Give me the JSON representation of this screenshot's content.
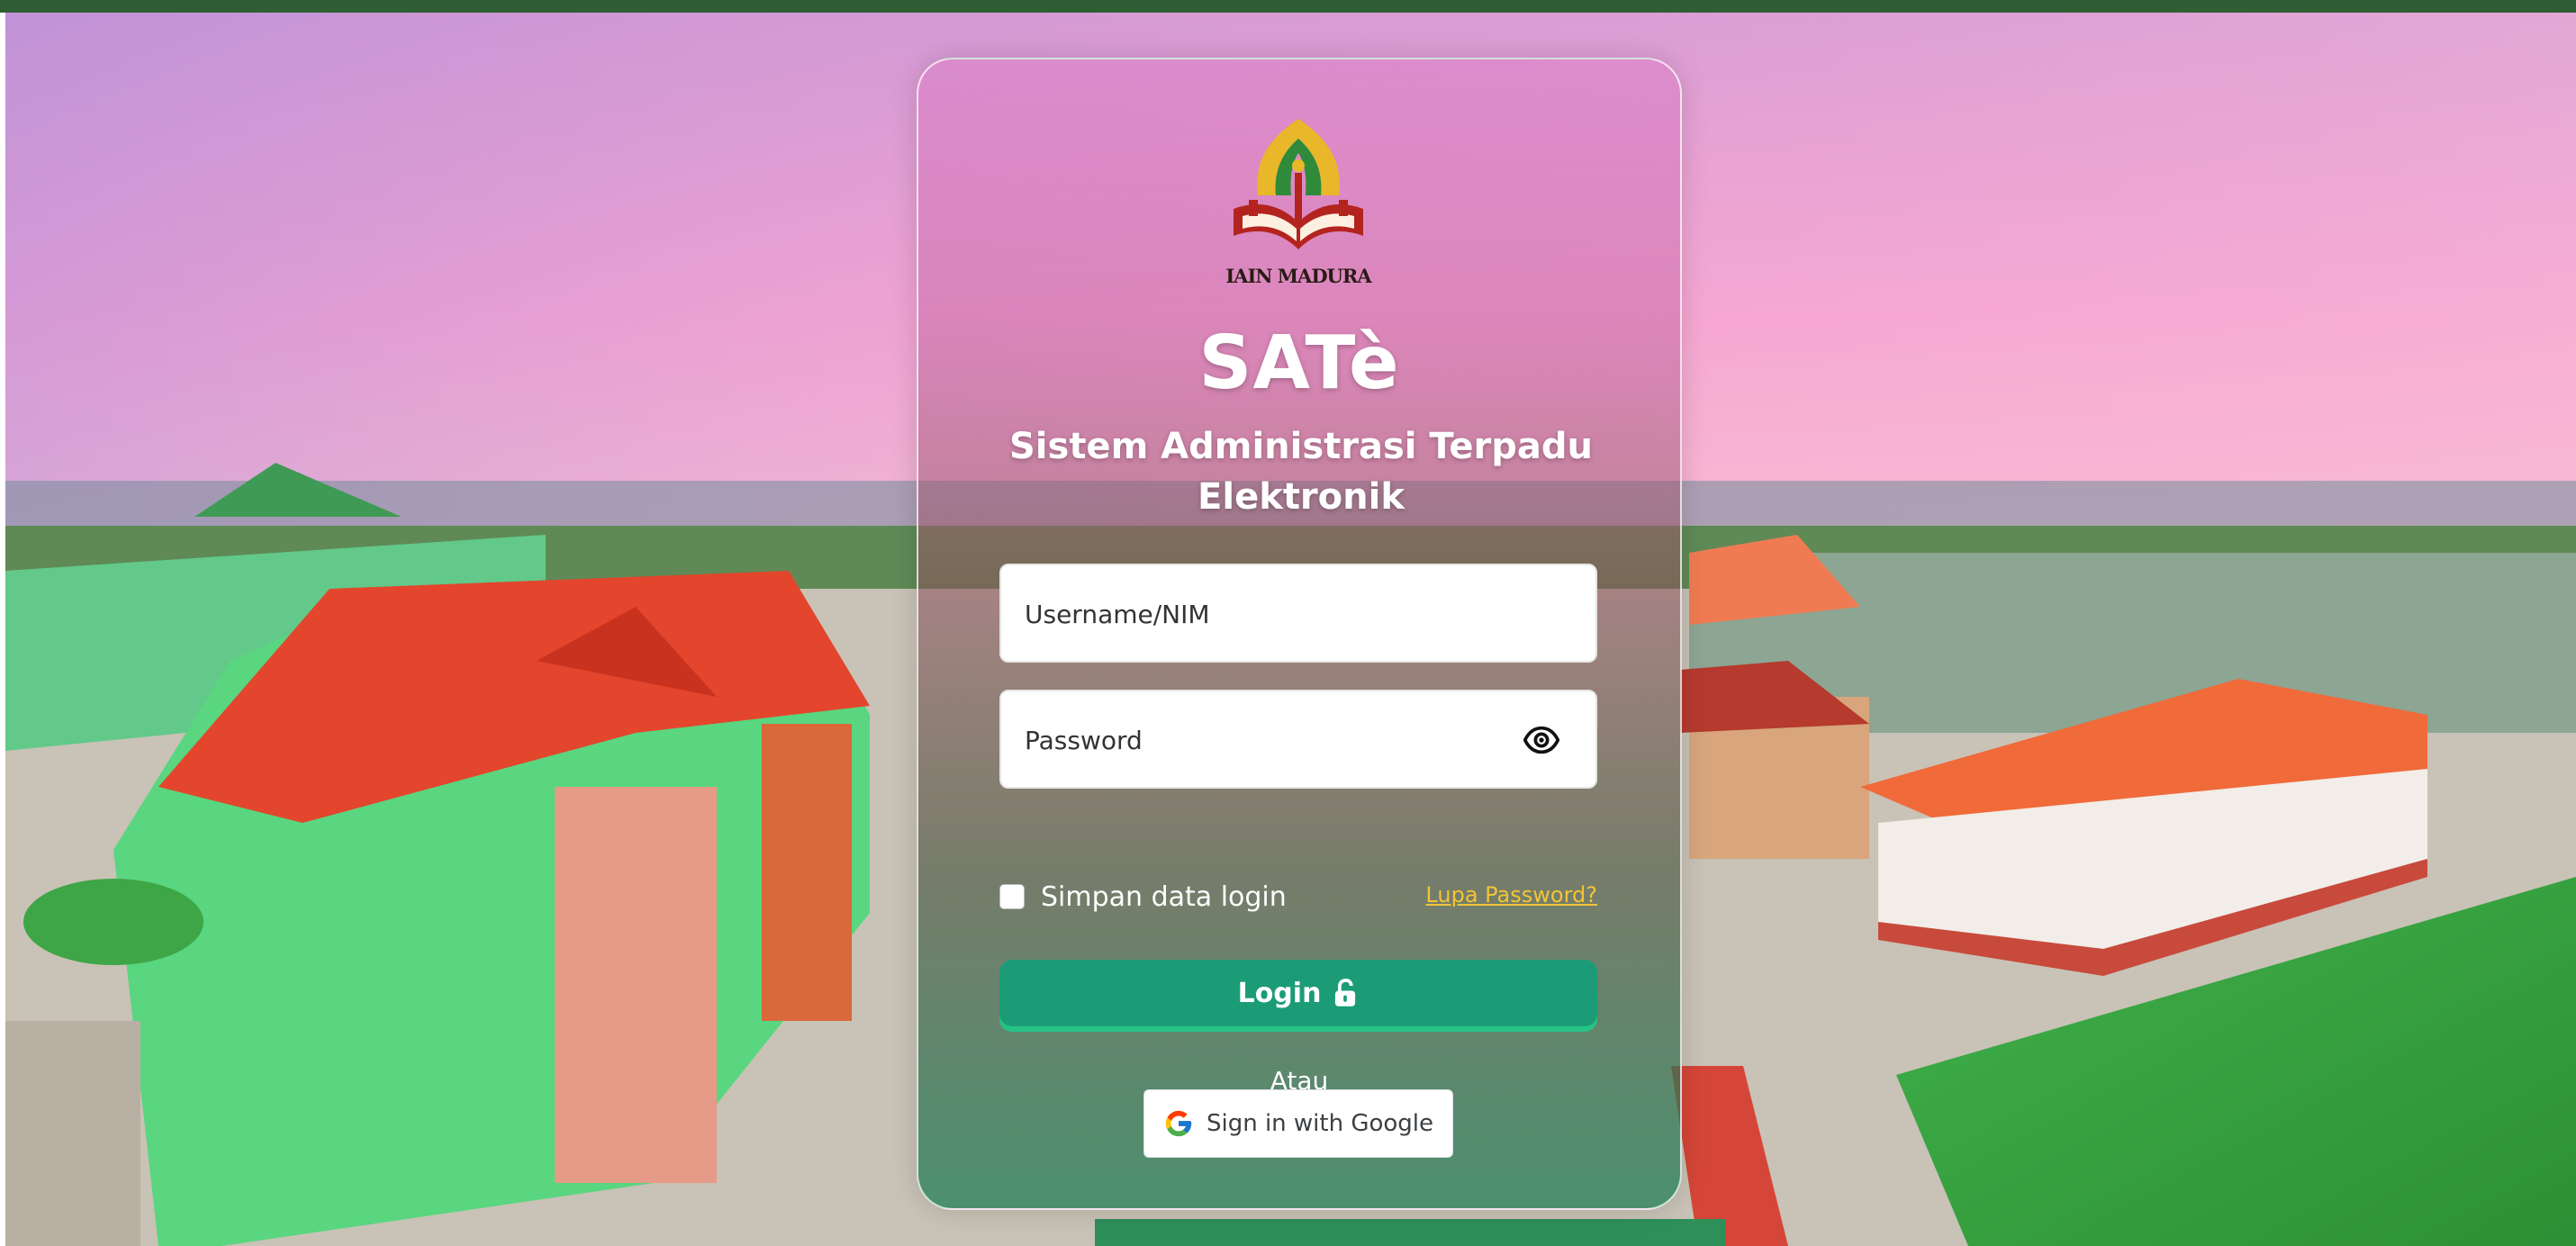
{
  "app": {
    "logo_text": "IAIN MADURA",
    "title": "SATè",
    "subtitle": "Sistem Administrasi Terpadu Elektronik"
  },
  "form": {
    "username_placeholder": "Username/NIM",
    "username_value": "",
    "password_placeholder": "Password",
    "password_value": "",
    "remember_label": "Simpan data login",
    "remember_checked": false,
    "forgot_label": "Lupa Password?",
    "login_label": "Login",
    "or_label": "Atau",
    "google_label": "Sign in with Google"
  },
  "icons": {
    "password_toggle": "eye-icon",
    "login": "unlock-icon",
    "google": "google-g-icon"
  },
  "colors": {
    "topbar": "#2f5e34",
    "login_button": "#1c9c76",
    "login_button_shadow": "#25c486",
    "forgot_link": "#f3c437"
  }
}
